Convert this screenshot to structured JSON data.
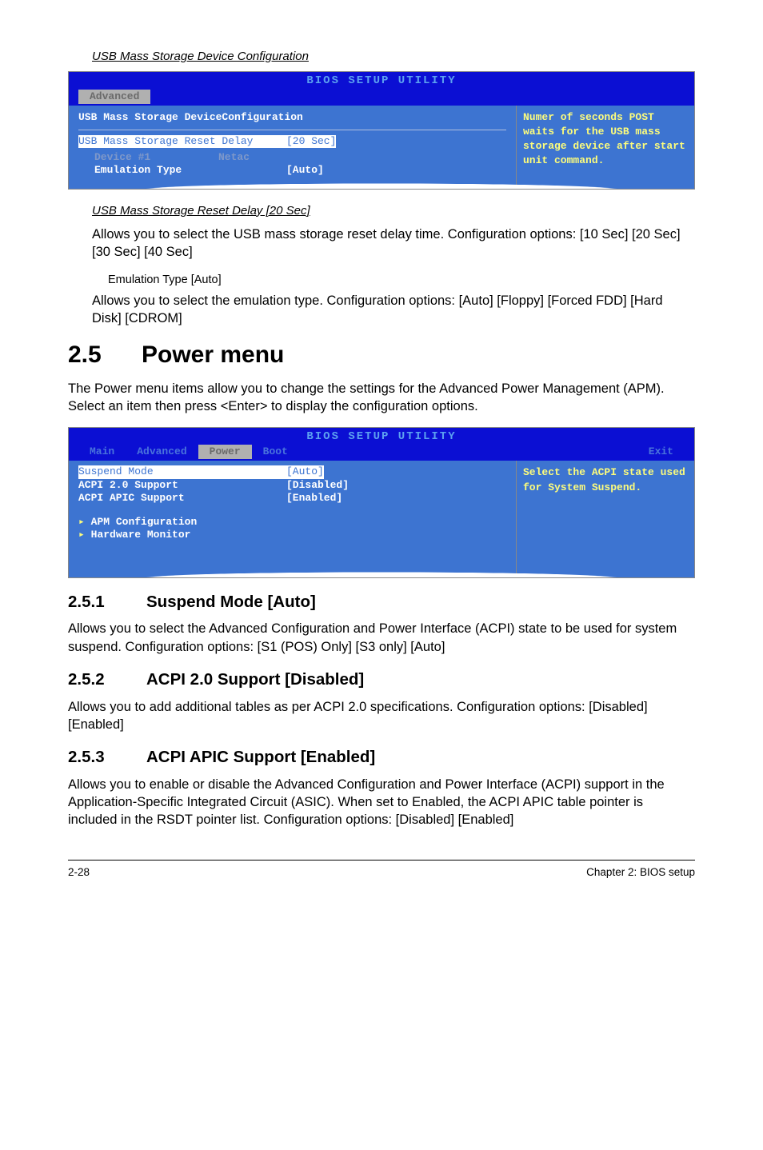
{
  "usb_config": {
    "screenshot_label": "USB Mass Storage Device Configuration",
    "bios_title": "BIOS SETUP UTILITY",
    "tab": "Advanced",
    "heading": "USB Mass Storage DeviceConfiguration",
    "reset_delay_label": "USB Mass Storage Reset Delay",
    "reset_delay_value": "[20 Sec]",
    "device_label": "Device #1",
    "device_value": "Netac",
    "emulation_label": "Emulation Type",
    "emulation_value": "[Auto]",
    "help_text": "Numer of seconds POST waits for the USB mass storage device after start unit command.",
    "reset_delay_heading": "USB Mass Storage Reset Delay [20 Sec]",
    "reset_delay_desc": "Allows you to select the USB mass storage reset delay time. Configuration options: [10 Sec] [20 Sec] [30 Sec] [40 Sec]",
    "emulation_heading": "Emulation Type [Auto]",
    "emulation_desc": "Allows you to select the emulation type. Configuration options: [Auto] [Floppy] [Forced FDD] [Hard Disk] [CDROM]"
  },
  "power_menu": {
    "number": "2.5",
    "title": "Power menu",
    "intro": "The Power menu items allow you to change the settings for the Advanced Power Management (APM). Select an item then press <Enter> to display the configuration options.",
    "bios_title": "BIOS SETUP UTILITY",
    "tabs": [
      "Main",
      "Advanced",
      "Power",
      "Boot",
      "Exit"
    ],
    "active_tab": "Power",
    "items": {
      "suspend_label": "Suspend Mode",
      "suspend_value": "[Auto]",
      "acpi20_label": "ACPI 2.0 Support",
      "acpi20_value": "[Disabled]",
      "acpi_apic_label": "ACPI APIC Support",
      "acpi_apic_value": "[Enabled]",
      "apm_config": "APM Configuration",
      "hw_monitor": "Hardware Monitor"
    },
    "help_text": "Select the ACPI state used for System Suspend."
  },
  "s251": {
    "number": "2.5.1",
    "title": "Suspend Mode [Auto]",
    "desc": "Allows you to select the Advanced Configuration and Power Interface (ACPI) state to be used for system suspend. Configuration options: [S1 (POS) Only] [S3 only] [Auto]"
  },
  "s252": {
    "number": "2.5.2",
    "title": "ACPI 2.0 Support [Disabled]",
    "desc": "Allows you to add  additional tables as per ACPI 2.0 specifications. Configuration options: [Disabled] [Enabled]"
  },
  "s253": {
    "number": "2.5.3",
    "title": "ACPI APIC Support [Enabled]",
    "desc": "Allows you to enable or disable the Advanced Configuration and Power Interface (ACPI) support in the Application-Specific Integrated Circuit (ASIC). When set to Enabled, the ACPI APIC table pointer is included in the RSDT pointer list. Configuration options: [Disabled] [Enabled]"
  },
  "footer": {
    "page": "2-28",
    "chapter": "Chapter 2: BIOS setup"
  }
}
